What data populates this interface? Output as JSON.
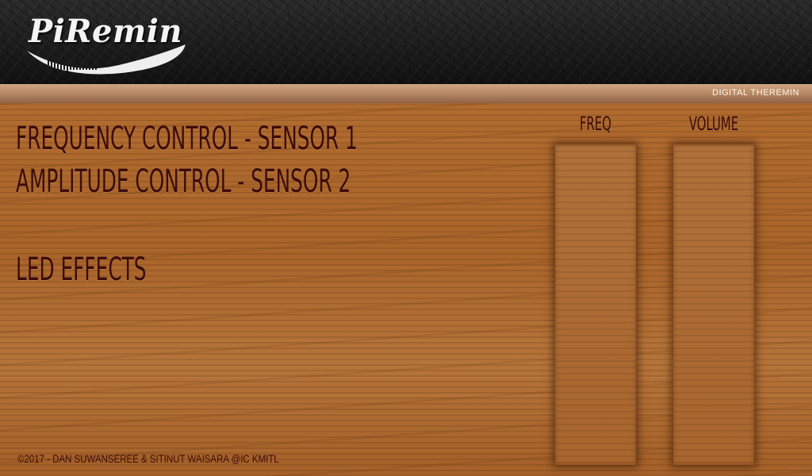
{
  "app": {
    "logo_text": "PiRemin",
    "subtitle": "DIGITAL THEREMIN"
  },
  "controls": {
    "frequency_label": "FREQUENCY CONTROL - SENSOR 1",
    "amplitude_label": "AMPLITUDE CONTROL - SENSOR 2",
    "led_label": "LED EFFECTS"
  },
  "meters": {
    "freq": {
      "title": "FREQ",
      "level": 0
    },
    "volume": {
      "title": "VOLUME",
      "level": 0
    }
  },
  "footer": {
    "credit": "©2017 - DAN SUWANSEREE & SITINUT WAISARA @IC KMITL"
  },
  "colors": {
    "label_text": "#3b0c0c",
    "logo_text": "#f4f4f4"
  }
}
